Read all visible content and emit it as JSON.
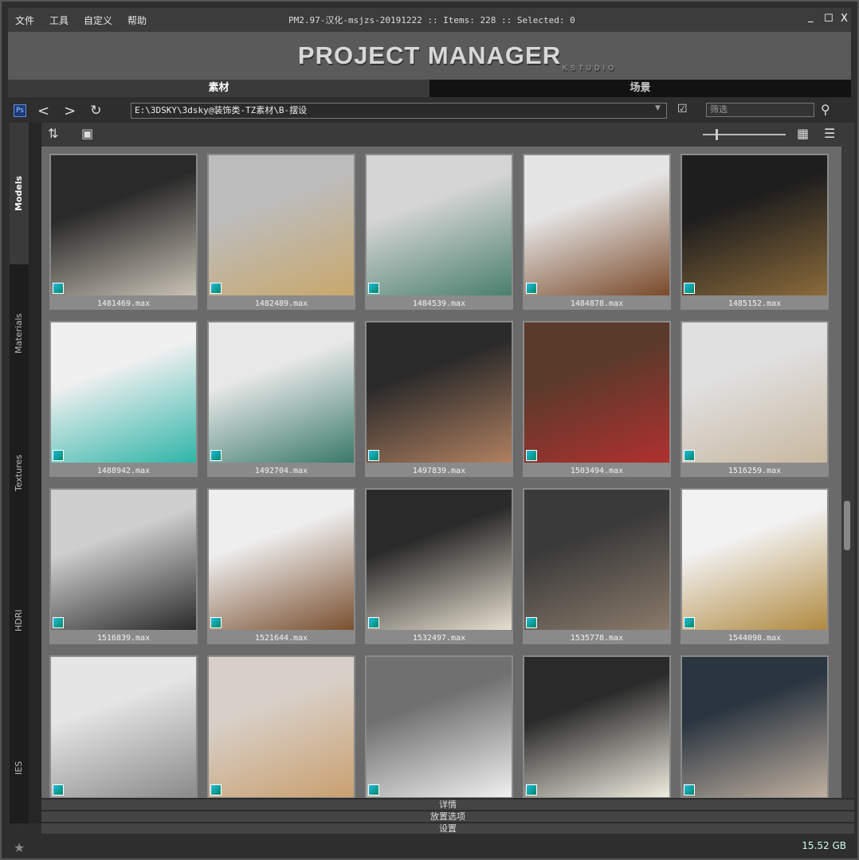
{
  "menu": [
    "文件",
    "工具",
    "自定义",
    "帮助"
  ],
  "window_title": "PM2.97-汉化-msjzs-20191222  :: Items: 228  :: Selected: 0",
  "logo": {
    "title": "PROJECT MANAGER",
    "sub": "KSTUDIO"
  },
  "tabs": [
    "素材",
    "场景"
  ],
  "path": "E:\\3DSKY\\3dsky@装饰类-TZ素材\\B-摆设",
  "filter_placeholder": "筛选",
  "sidebar": [
    "Models",
    "Materials",
    "Textures",
    "HDRI",
    "IES"
  ],
  "items": [
    {
      "name": "1481469.max",
      "c": [
        "#2a2a2a",
        "#c9c2b5"
      ]
    },
    {
      "name": "1482489.max",
      "c": [
        "#bdbdbd",
        "#c8a86c"
      ]
    },
    {
      "name": "1484539.max",
      "c": [
        "#d5d5d5",
        "#4a7f6e"
      ]
    },
    {
      "name": "1484878.max",
      "c": [
        "#e5e5e5",
        "#7a4a2a"
      ]
    },
    {
      "name": "1485152.max",
      "c": [
        "#1e1e1e",
        "#8a6a3a"
      ]
    },
    {
      "name": "1488942.max",
      "c": [
        "#f0f0f0",
        "#2fb5a8"
      ]
    },
    {
      "name": "1492704.max",
      "c": [
        "#e8e8e8",
        "#3a7a6a"
      ]
    },
    {
      "name": "1497839.max",
      "c": [
        "#2a2a2a",
        "#b08060"
      ]
    },
    {
      "name": "1503494.max",
      "c": [
        "#5a3a2a",
        "#b03030"
      ]
    },
    {
      "name": "1516259.max",
      "c": [
        "#e0e0e0",
        "#c8b8a0"
      ]
    },
    {
      "name": "1516839.max",
      "c": [
        "#cfcfcf",
        "#2a2a2a"
      ]
    },
    {
      "name": "1521644.max",
      "c": [
        "#eeeeee",
        "#7a5030"
      ]
    },
    {
      "name": "1532497.max",
      "c": [
        "#2a2a2a",
        "#e8e0d0"
      ]
    },
    {
      "name": "1535778.max",
      "c": [
        "#3a3a3a",
        "#8a7a6a"
      ]
    },
    {
      "name": "1544098.max",
      "c": [
        "#f2f2f2",
        "#b08a40"
      ]
    },
    {
      "name": "",
      "c": [
        "#e5e5e5",
        "#8a8a8a"
      ]
    },
    {
      "name": "",
      "c": [
        "#d8d0c8",
        "#c9a070"
      ]
    },
    {
      "name": "",
      "c": [
        "#707070",
        "#f0f0f0"
      ]
    },
    {
      "name": "",
      "c": [
        "#2a2a2a",
        "#f0ece0"
      ]
    },
    {
      "name": "",
      "c": [
        "#2a3540",
        "#c0b0a0"
      ]
    }
  ],
  "accordion": [
    "详情",
    "放置选项",
    "设置"
  ],
  "disk": "15.52 GB"
}
